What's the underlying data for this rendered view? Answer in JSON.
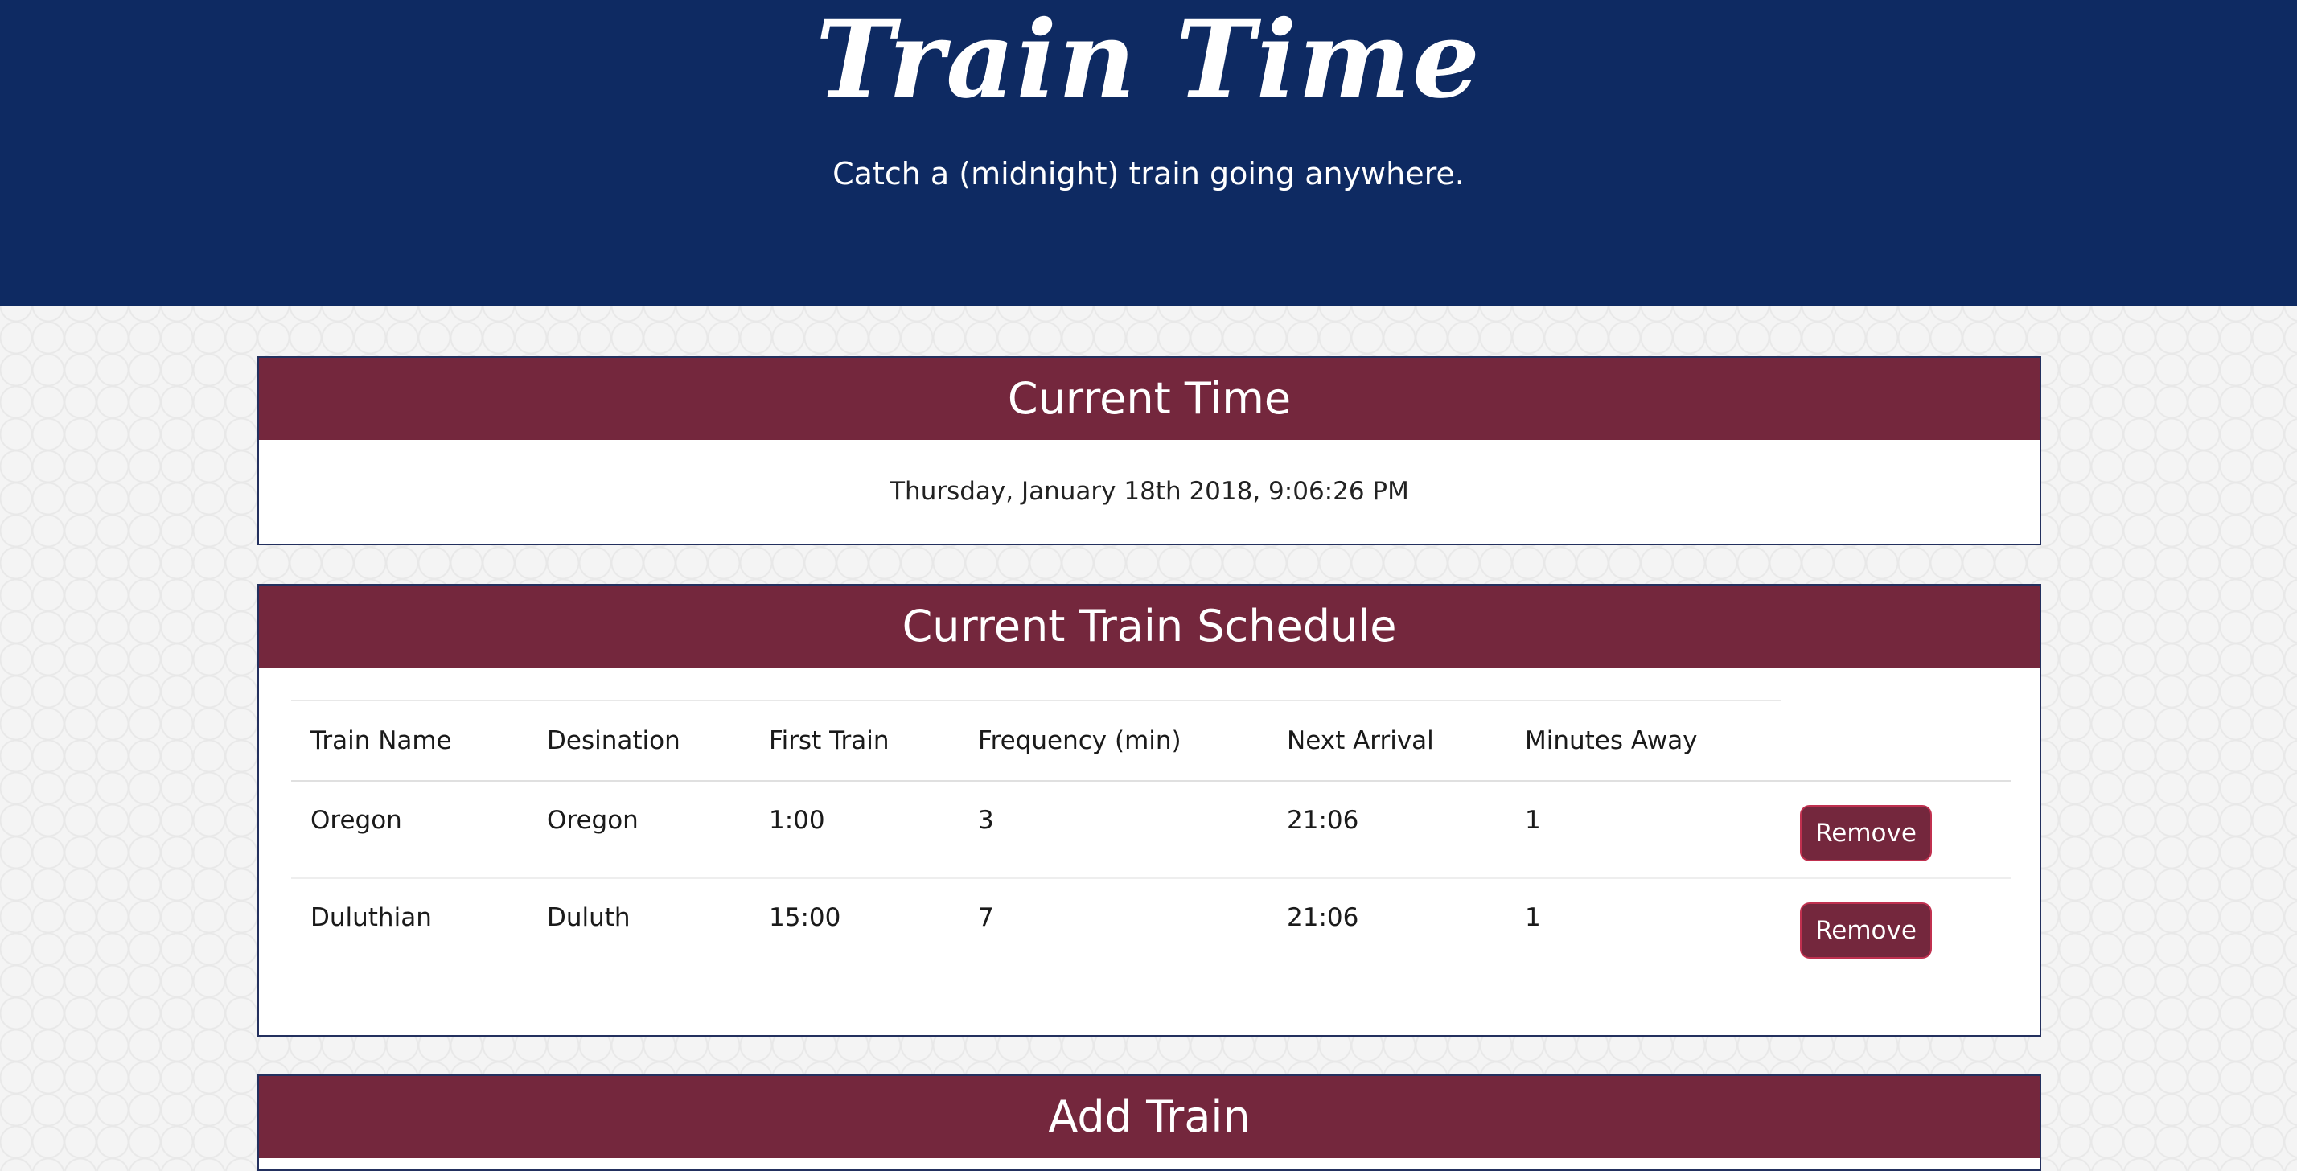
{
  "header": {
    "title": "Train Time",
    "subtitle": "Catch a (midnight) train going anywhere."
  },
  "current_time": {
    "heading": "Current Time",
    "value": "Thursday, January 18th 2018, 9:06:26 PM"
  },
  "schedule": {
    "heading": "Current Train Schedule",
    "columns": [
      "Train Name",
      "Desination",
      "First Train",
      "Frequency (min)",
      "Next Arrival",
      "Minutes Away"
    ],
    "rows": [
      {
        "name": "Oregon",
        "destination": "Oregon",
        "first_train": "1:00",
        "frequency": "3",
        "next_arrival": "21:06",
        "minutes_away": "1",
        "action": "Remove"
      },
      {
        "name": "Duluthian",
        "destination": "Duluth",
        "first_train": "15:00",
        "frequency": "7",
        "next_arrival": "21:06",
        "minutes_away": "1",
        "action": "Remove"
      }
    ]
  },
  "add_train": {
    "heading": "Add Train"
  },
  "colors": {
    "header_bg": "#0e2a62",
    "panel_heading_bg": "#74273d",
    "panel_border": "#23305e"
  }
}
